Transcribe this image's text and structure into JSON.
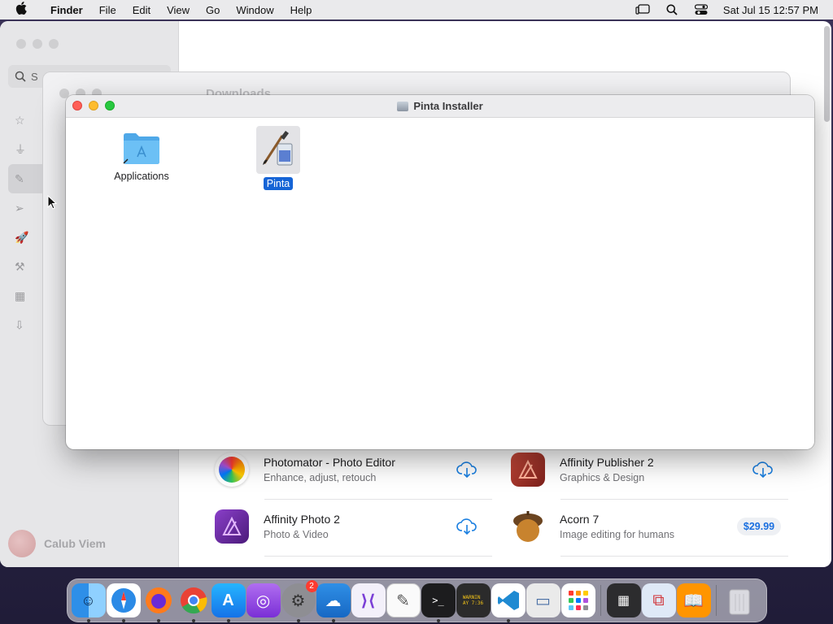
{
  "menubar": {
    "app_name": "Finder",
    "items": [
      "File",
      "Edit",
      "View",
      "Go",
      "Window",
      "Help"
    ],
    "datetime": "Sat Jul 15  12:57 PM"
  },
  "appstore": {
    "search_partial": "S",
    "user_name": "Calub Viem",
    "apps": [
      {
        "name": "Photomator - Photo Editor",
        "subtitle": "Enhance, adjust, retouch",
        "action": "download"
      },
      {
        "name": "Affinity Publisher 2",
        "subtitle": "Graphics & Design",
        "action": "download"
      },
      {
        "name": "Affinity Photo 2",
        "subtitle": "Photo & Video",
        "action": "download"
      },
      {
        "name": "Acorn 7",
        "subtitle": "Image editing for humans",
        "action": "price",
        "price": "$29.99"
      }
    ]
  },
  "finder_back": {
    "title": "Downloads"
  },
  "pinta_window": {
    "title": "Pinta Installer",
    "items": [
      {
        "label": "Applications",
        "icon": "applications-folder-icon",
        "selected": false
      },
      {
        "label": "Pinta",
        "icon": "pinta-app-icon",
        "selected": true
      }
    ]
  },
  "dock": {
    "apps": [
      "Finder",
      "Safari",
      "Firefox",
      "Chrome",
      "App Store",
      "Podcasts",
      "System Settings",
      "Weather",
      "Visual Studio",
      "TextEdit",
      "Terminal",
      "Console",
      "VS Code",
      "Preview",
      "Launchpad",
      "Calculator",
      "Remote Desktop",
      "Books",
      "Trash"
    ],
    "settings_badge": "2",
    "console_text": "WARNIN\nAY 7:36"
  }
}
